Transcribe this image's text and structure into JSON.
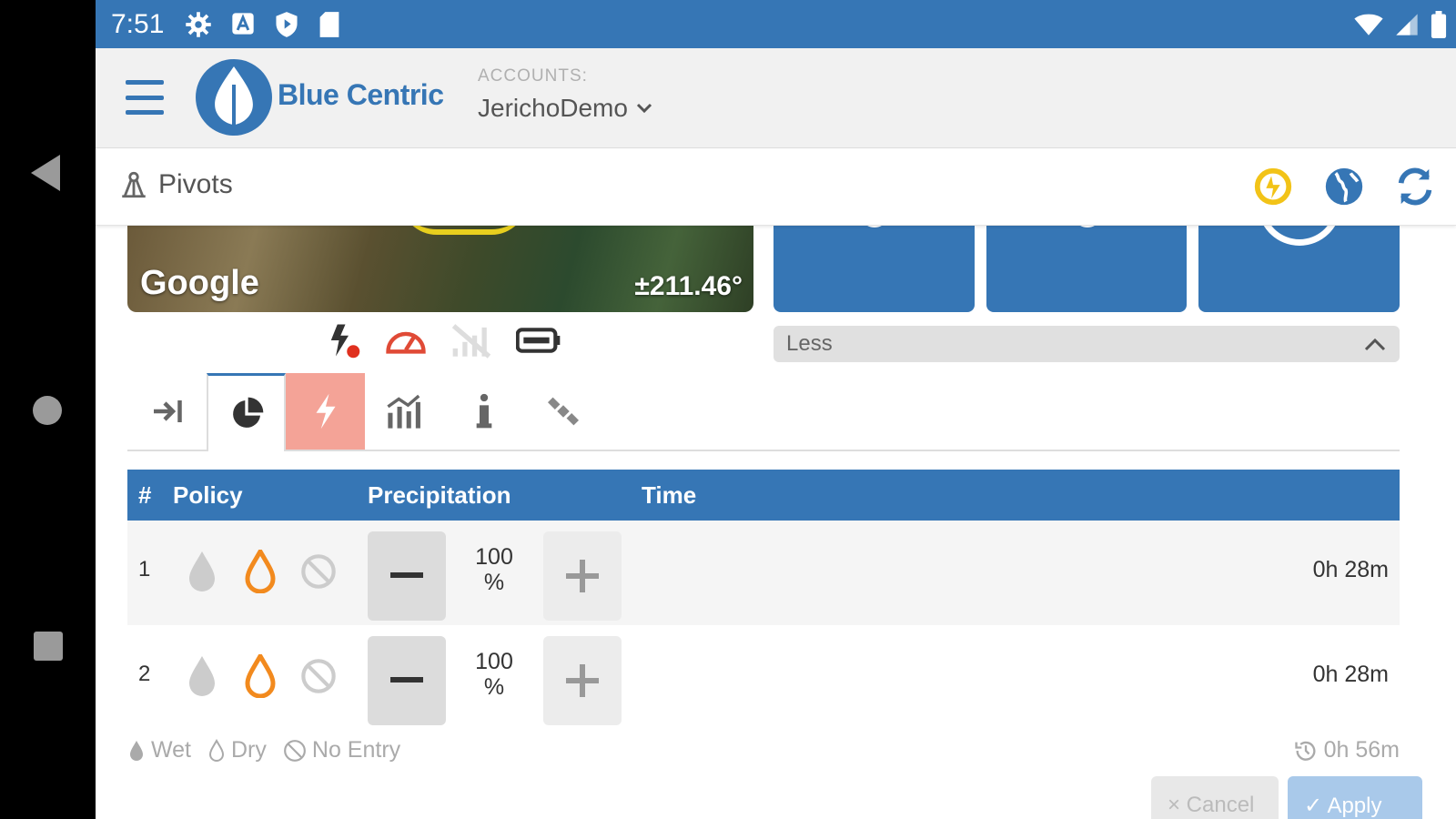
{
  "statusbar": {
    "time": "7:51"
  },
  "header": {
    "brand": "Blue Centric",
    "accounts_label": "ACCOUNTS:",
    "account": "JerichoDemo"
  },
  "subbar": {
    "title": "Pivots"
  },
  "map": {
    "attribution": "Google",
    "angle": "±211.46°"
  },
  "panel": {
    "less_label": "Less"
  },
  "table": {
    "headers": {
      "num": "#",
      "policy": "Policy",
      "precipitation": "Precipitation",
      "time": "Time"
    },
    "rows": [
      {
        "num": "1",
        "precip": "100",
        "unit": "%",
        "time": "0h 28m",
        "policy": "dry"
      },
      {
        "num": "2",
        "precip": "100",
        "unit": "%",
        "time": "0h 28m",
        "policy": "dry"
      }
    ]
  },
  "legend": {
    "wet": "Wet",
    "dry": "Dry",
    "no_entry": "No Entry",
    "total_time": "0h 56m"
  },
  "actions": {
    "cancel": "× Cancel",
    "apply": "✓ Apply"
  },
  "colors": {
    "primary": "#3676b5",
    "accent_orange": "#f28a1e",
    "alert_tab": "#f4a397",
    "highlight_yellow": "#f2c318"
  }
}
